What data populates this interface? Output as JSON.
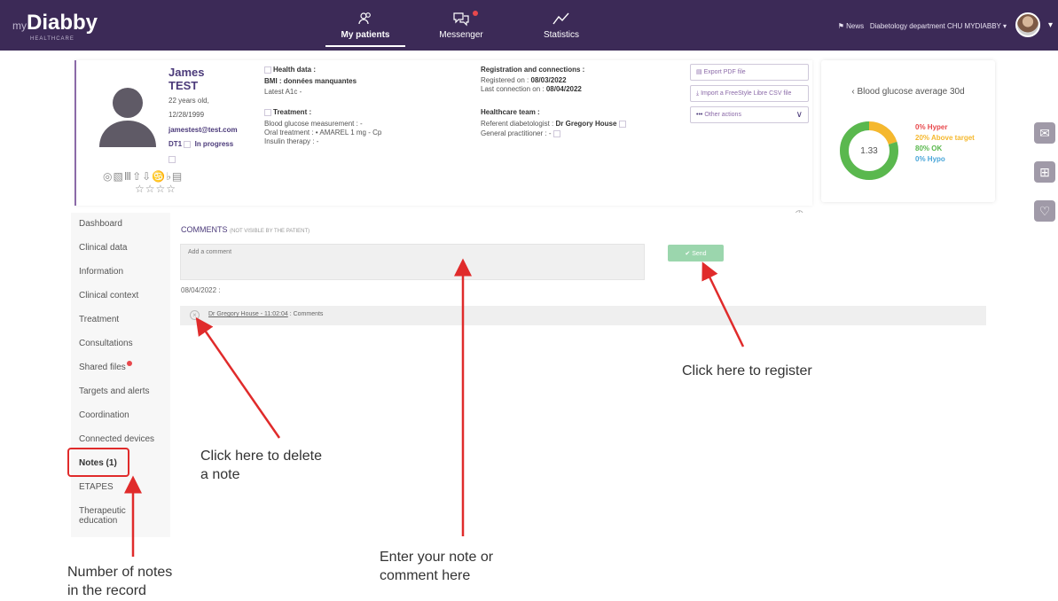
{
  "topbar": {
    "logo_prefix": "my",
    "logo": "Diabby",
    "logo_sub": "HEALTHCARE",
    "nav": [
      {
        "label": "My patients",
        "icon": "patients-icon",
        "active": true
      },
      {
        "label": "Messenger",
        "icon": "messenger-icon",
        "active": false
      },
      {
        "label": "Statistics",
        "icon": "statistics-icon",
        "active": false
      }
    ],
    "news_label": "News",
    "department": "Diabetology department CHU MYDIABBY"
  },
  "patient": {
    "first_name": "James",
    "last_name": "TEST",
    "age": "22 years old,",
    "birthdate": "12/28/1999",
    "email": "jamestest@test.com",
    "type": "DT1",
    "status": "In progress",
    "health_data_title": "Health data :",
    "bmi": "BMI : données manquantes",
    "latest_a1c": "Latest A1c -",
    "treatment_title": "Treatment :",
    "treatment_lines": [
      "Blood glucose measurement : -",
      "Oral treatment :  •  AMAREL 1 mg - Cp",
      "Insulin therapy : -"
    ],
    "registration_title": "Registration and connections :",
    "registered_label": "Registered on :",
    "registered_date": "08/03/2022",
    "last_conn_label": "Last connection on :",
    "last_conn_date": "08/04/2022",
    "team_title": "Healthcare team :",
    "referent_label": "Referent diabetologist :",
    "referent_name": "Dr Gregory House",
    "gp_label": "General practitioner : -",
    "actions": [
      "Export PDF file",
      "Import a FreeStyle Libre CSV file",
      "Other actions"
    ]
  },
  "glucose": {
    "title": "Blood glucose average 30d",
    "value": "1.33",
    "legend": [
      {
        "label": "0% Hyper",
        "color": "#e8484c"
      },
      {
        "label": "20% Above target",
        "color": "#f5b82e"
      },
      {
        "label": "80% OK",
        "color": "#5ab84e"
      },
      {
        "label": "0% Hypo",
        "color": "#4aa6d9"
      }
    ],
    "segments": [
      {
        "name": "Above target",
        "value": 20,
        "color": "#f5b82e"
      },
      {
        "name": "OK",
        "value": 80,
        "color": "#5ab84e"
      }
    ]
  },
  "menu": [
    "Dashboard",
    "Clinical data",
    "Information",
    "Clinical context",
    "Treatment",
    "Consultations",
    "Shared files",
    "Targets and alerts",
    "Coordination",
    "Connected devices",
    "Notes (1)",
    "ETAPES",
    "Therapeutic",
    "education"
  ],
  "comments": {
    "title": "COMMENTS",
    "subtitle": "(NOT VISIBLE BY THE PATIENT)",
    "placeholder": "Add a comment",
    "send_label": "✔ Send",
    "date": "08/04/2022 :",
    "entry_author": "Dr Gregory  House - 11:02:04",
    "entry_text": " : Comments"
  },
  "annotations": {
    "register": "Click here to register",
    "delete_1": "Click here to delete",
    "delete_2": "a note",
    "enter_1": "Enter your note or",
    "enter_2": "comment here",
    "count_1": "Number of notes",
    "count_2": "in the record"
  },
  "colors": {
    "header_bg": "#3c2a57",
    "accent": "#4b3a7a",
    "send_bg": "#9bd6ad",
    "annotation_red": "#e02b2b"
  }
}
